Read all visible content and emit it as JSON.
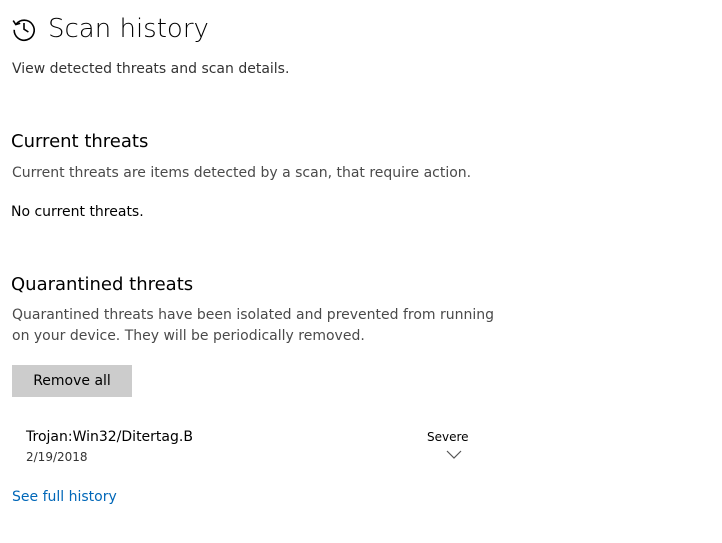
{
  "header": {
    "title": "Scan history",
    "icon": "history-icon"
  },
  "subtitle": "View detected threats and scan details.",
  "current_threats": {
    "title": "Current threats",
    "description": "Current threats are items detected by a scan, that require action.",
    "status": "No current threats."
  },
  "quarantined_threats": {
    "title": "Quarantined threats",
    "description": "Quarantined threats have been isolated and prevented from running on your device.  They will be periodically removed.",
    "remove_all_label": "Remove all",
    "items": [
      {
        "name": "Trojan:Win32/Ditertag.B",
        "date": "2/19/2018",
        "severity": "Severe"
      }
    ]
  },
  "see_full_history_label": "See full history",
  "colors": {
    "link": "#0067b8",
    "button_bg": "#cccccc"
  }
}
